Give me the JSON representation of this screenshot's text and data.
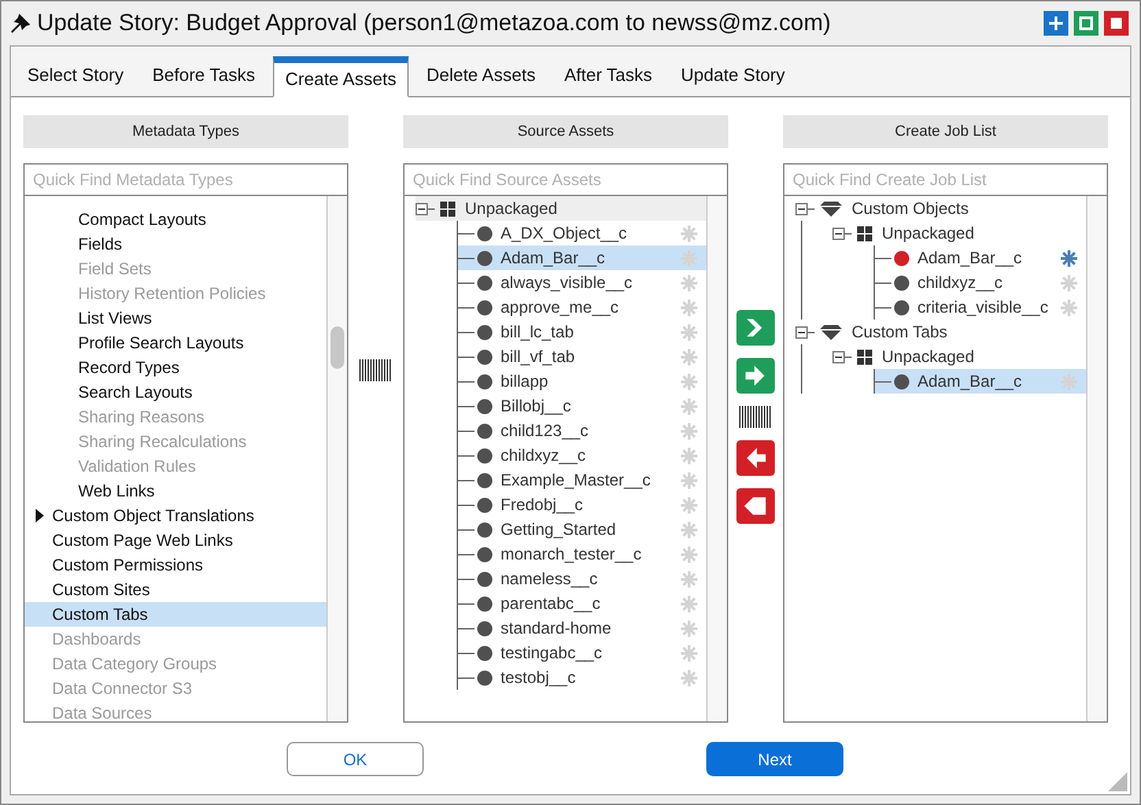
{
  "window": {
    "title": "Update Story: Budget Approval (person1@metazoa.com to newss@mz.com)"
  },
  "tabs": [
    {
      "label": "Select Story",
      "selected": false
    },
    {
      "label": "Before Tasks",
      "selected": false
    },
    {
      "label": "Create Assets",
      "selected": true
    },
    {
      "label": "Delete Assets",
      "selected": false
    },
    {
      "label": "After Tasks",
      "selected": false
    },
    {
      "label": "Update Story",
      "selected": false
    }
  ],
  "metadata_types": {
    "header": "Metadata Types",
    "search": {
      "placeholder": "Quick Find Metadata Types"
    },
    "items": [
      {
        "children": [
          {
            "label": "Compact Layouts",
            "disabled": false,
            "selected": false
          },
          {
            "label": "Fields",
            "disabled": false,
            "selected": false
          },
          {
            "label": "Field Sets",
            "disabled": true,
            "selected": false
          },
          {
            "label": "History Retention Policies",
            "disabled": true,
            "selected": false
          },
          {
            "label": "List Views",
            "disabled": false,
            "selected": false
          },
          {
            "label": "Profile Search Layouts",
            "disabled": false,
            "selected": false
          },
          {
            "label": "Record Types",
            "disabled": false,
            "selected": false
          },
          {
            "label": "Search Layouts",
            "disabled": false,
            "selected": false
          },
          {
            "label": "Sharing Reasons",
            "disabled": true,
            "selected": false
          },
          {
            "label": "Sharing Recalculations",
            "disabled": true,
            "selected": false
          },
          {
            "label": "Validation Rules",
            "disabled": true,
            "selected": false
          },
          {
            "label": "Web Links",
            "disabled": false,
            "selected": false
          }
        ]
      },
      {
        "label": "Custom Object Translations",
        "disabled": false,
        "selected": false,
        "collapsed": true
      },
      {
        "label": "Custom Page Web Links",
        "disabled": false,
        "selected": false,
        "collapsed": false
      },
      {
        "label": "Custom Permissions",
        "disabled": false,
        "selected": false,
        "collapsed": false
      },
      {
        "label": "Custom Sites",
        "disabled": false,
        "selected": false,
        "collapsed": false
      },
      {
        "label": "Custom Tabs",
        "disabled": false,
        "selected": true,
        "collapsed": false
      },
      {
        "label": "Dashboards",
        "disabled": true,
        "selected": false,
        "collapsed": false
      },
      {
        "label": "Data Category Groups",
        "disabled": true,
        "selected": false,
        "collapsed": false
      },
      {
        "label": "Data Connector S3",
        "disabled": true,
        "selected": false,
        "collapsed": false
      },
      {
        "label": "Data Sources",
        "disabled": true,
        "selected": false,
        "collapsed": false
      }
    ]
  },
  "source_assets": {
    "header": "Source Assets",
    "search": {
      "placeholder": "Quick Find Source Assets"
    },
    "tree": [
      {
        "label": "Unpackaged",
        "kind": "package",
        "expanded": true,
        "children": [
          {
            "label": "A_DX_Object__c",
            "kind": "asset",
            "selected": false,
            "color": "#505050",
            "starred": false
          },
          {
            "label": "Adam_Bar__c",
            "kind": "asset",
            "selected": true,
            "color": "#505050",
            "starred": false
          },
          {
            "label": "always_visible__c",
            "kind": "asset",
            "selected": false,
            "color": "#505050",
            "starred": false
          },
          {
            "label": "approve_me__c",
            "kind": "asset",
            "selected": false,
            "color": "#505050",
            "starred": false
          },
          {
            "label": "bill_lc_tab",
            "kind": "asset",
            "selected": false,
            "color": "#505050",
            "starred": false
          },
          {
            "label": "bill_vf_tab",
            "kind": "asset",
            "selected": false,
            "color": "#505050",
            "starred": false
          },
          {
            "label": "billapp",
            "kind": "asset",
            "selected": false,
            "color": "#505050",
            "starred": false
          },
          {
            "label": "Billobj__c",
            "kind": "asset",
            "selected": false,
            "color": "#505050",
            "starred": false
          },
          {
            "label": "child123__c",
            "kind": "asset",
            "selected": false,
            "color": "#505050",
            "starred": false
          },
          {
            "label": "childxyz__c",
            "kind": "asset",
            "selected": false,
            "color": "#505050",
            "starred": false
          },
          {
            "label": "Example_Master__c",
            "kind": "asset",
            "selected": false,
            "color": "#505050",
            "starred": false
          },
          {
            "label": "Fredobj__c",
            "kind": "asset",
            "selected": false,
            "color": "#505050",
            "starred": false
          },
          {
            "label": "Getting_Started",
            "kind": "asset",
            "selected": false,
            "color": "#505050",
            "starred": false
          },
          {
            "label": "monarch_tester__c",
            "kind": "asset",
            "selected": false,
            "color": "#505050",
            "starred": false
          },
          {
            "label": "nameless__c",
            "kind": "asset",
            "selected": false,
            "color": "#505050",
            "starred": false
          },
          {
            "label": "parentabc__c",
            "kind": "asset",
            "selected": false,
            "color": "#505050",
            "starred": false
          },
          {
            "label": "standard-home",
            "kind": "asset",
            "selected": false,
            "color": "#505050",
            "starred": false
          },
          {
            "label": "testingabc__c",
            "kind": "asset",
            "selected": false,
            "color": "#505050",
            "starred": false
          },
          {
            "label": "testobj__c",
            "kind": "asset",
            "selected": false,
            "color": "#505050",
            "starred": false
          }
        ]
      }
    ]
  },
  "job_list": {
    "header": "Create Job List",
    "search": {
      "placeholder": "Quick Find Create Job List"
    },
    "tree": [
      {
        "label": "Custom Objects",
        "kind": "type",
        "expanded": true,
        "children": [
          {
            "label": "Unpackaged",
            "kind": "package",
            "expanded": true,
            "children": [
              {
                "label": "Adam_Bar__c",
                "kind": "asset",
                "selected": false,
                "color": "#d32027",
                "starred": true
              },
              {
                "label": "childxyz__c",
                "kind": "asset",
                "selected": false,
                "color": "#505050",
                "starred": false
              },
              {
                "label": "criteria_visible__c",
                "kind": "asset",
                "selected": false,
                "color": "#505050",
                "starred": false
              }
            ]
          }
        ]
      },
      {
        "label": "Custom Tabs",
        "kind": "type",
        "expanded": true,
        "children": [
          {
            "label": "Unpackaged",
            "kind": "package",
            "expanded": true,
            "children": [
              {
                "label": "Adam_Bar__c",
                "kind": "asset",
                "selected": true,
                "color": "#505050",
                "starred": false
              }
            ]
          }
        ]
      }
    ]
  },
  "move_buttons": [
    {
      "kind": "add_all"
    },
    {
      "kind": "add"
    },
    {
      "kind": "remove"
    },
    {
      "kind": "remove_all"
    }
  ],
  "buttons": [
    {
      "label": "OK",
      "kind": "secondary"
    },
    {
      "label": "Next",
      "kind": "primary"
    }
  ]
}
